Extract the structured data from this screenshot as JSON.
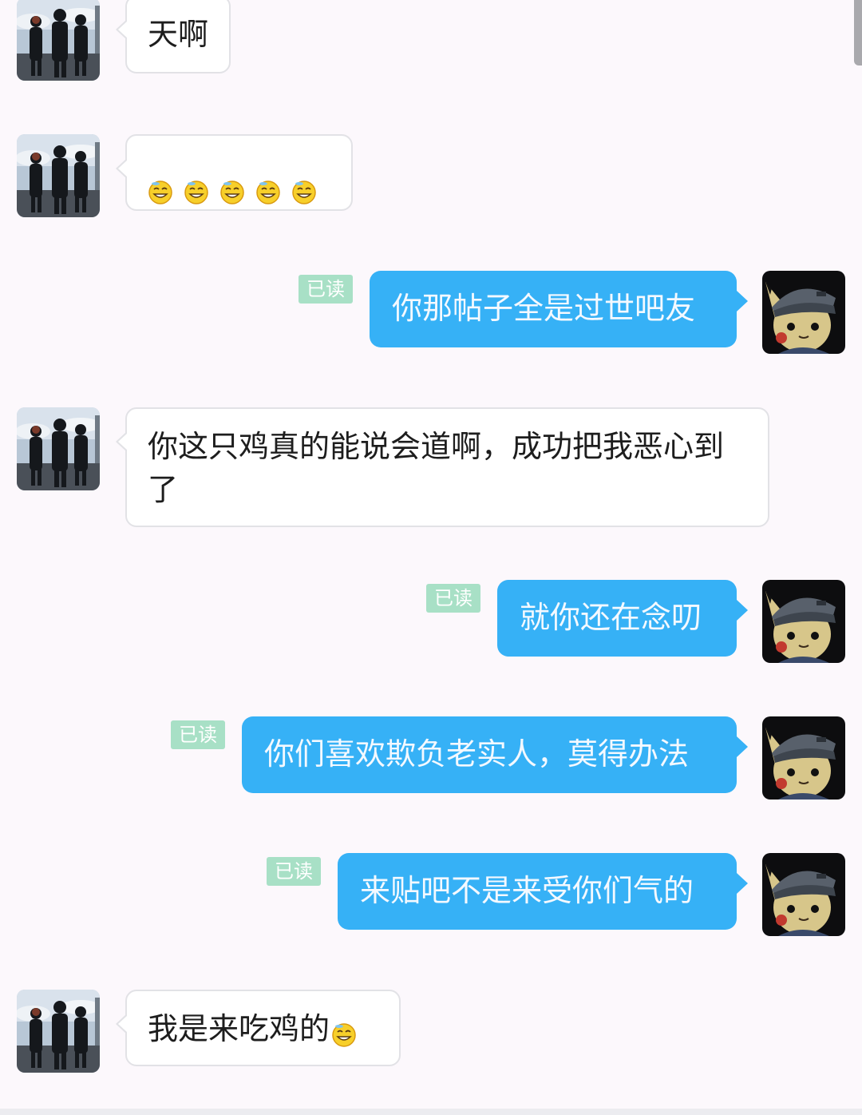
{
  "read_label": "已读",
  "messages": [
    {
      "side": "left",
      "text": "天啊"
    },
    {
      "side": "left",
      "text": "",
      "emoji_count": 5
    },
    {
      "side": "right",
      "text": "你那帖子全是过世吧友"
    },
    {
      "side": "left",
      "text": "你这只鸡真的能说会道啊，成功把我恶心到了"
    },
    {
      "side": "right",
      "text": "就你还在念叨"
    },
    {
      "side": "right",
      "text": "你们喜欢欺负老实人，莫得办法"
    },
    {
      "side": "right",
      "text": "来贴吧不是来受你们气的"
    },
    {
      "side": "left",
      "text": "我是来吃鸡的"
    }
  ],
  "colors": {
    "background": "#fcf8fc",
    "outgoing_bubble": "#36b1f6",
    "incoming_bubble": "#ffffff",
    "read_badge": "#a8e0c6"
  }
}
